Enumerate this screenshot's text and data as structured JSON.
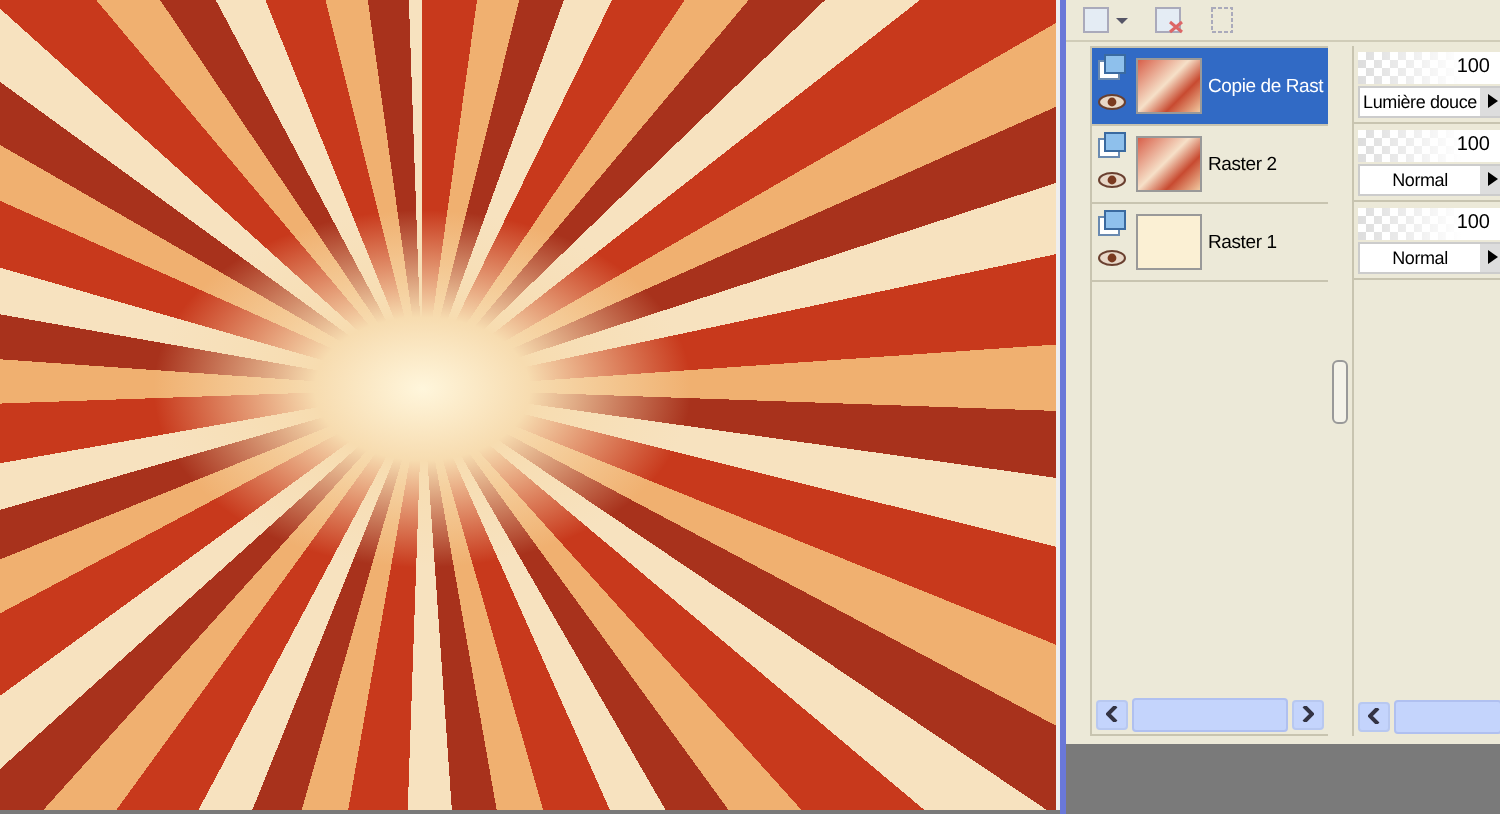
{
  "layers": [
    {
      "name": "Copie de Rast",
      "selected": true,
      "visible": true,
      "kind": "image",
      "opacity": "100",
      "blend_mode": "Lumière douce"
    },
    {
      "name": "Raster 2",
      "selected": false,
      "visible": true,
      "kind": "image",
      "opacity": "100",
      "blend_mode": "Normal"
    },
    {
      "name": "Raster 1",
      "selected": false,
      "visible": true,
      "kind": "fill",
      "opacity": "100",
      "blend_mode": "Normal"
    }
  ]
}
